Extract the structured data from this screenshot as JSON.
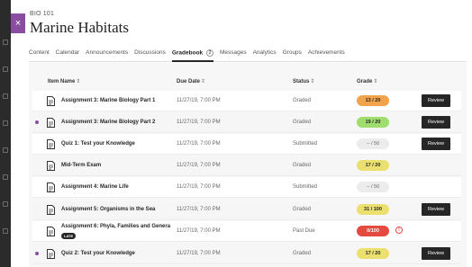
{
  "app": {
    "course_code": "BIO 101",
    "course_title": "Marine Habitats",
    "close_glyph": "×"
  },
  "tabs": [
    {
      "label": "Content"
    },
    {
      "label": "Calendar"
    },
    {
      "label": "Announcements"
    },
    {
      "label": "Discussions"
    },
    {
      "label": "Gradebook",
      "badge": "2",
      "active": true
    },
    {
      "label": "Messages"
    },
    {
      "label": "Analytics"
    },
    {
      "label": "Groups"
    },
    {
      "label": "Achievements"
    }
  ],
  "columns": {
    "item_name": "Item Name",
    "due_date": "Due Date",
    "status": "Status",
    "grade": "Grade",
    "sort_glyph": "⇕"
  },
  "rows": [
    {
      "name": "Assignment 3: Marine Biology Part 1",
      "due": "11/27/19, 7:00 PM",
      "status": "Graded",
      "grade": "13 / 20",
      "grade_color": "orange",
      "review": "Review",
      "new": false
    },
    {
      "name": "Assignment 3: Marine Biology Part 2",
      "due": "11/27/19, 7:00 PM",
      "status": "Graded",
      "grade": "19 / 20",
      "grade_color": "green",
      "review": "Review",
      "new": true
    },
    {
      "name": "Quiz 1: Test your Knowledge",
      "due": "11/27/19, 7:00 PM",
      "status": "Submitted",
      "grade": "-- / 50",
      "grade_color": "grey",
      "review": "Review",
      "new": false
    },
    {
      "name": "Mid-Term Exam",
      "due": "11/27/19, 7:00 PM",
      "status": "Graded",
      "grade": "17 / 20",
      "grade_color": "yellow",
      "new": false
    },
    {
      "name": "Assignment 4: Marine Life",
      "due": "11/27/19, 7:00 PM",
      "status": "Submitted",
      "grade": "-- / 50",
      "grade_color": "grey",
      "new": false
    },
    {
      "name": "Assignment 5: Organisms in the Sea",
      "due": "11/27/19, 7:00 PM",
      "status": "Graded",
      "grade": "31 / 100",
      "grade_color": "yellow",
      "review": "Review",
      "new": false
    },
    {
      "name": "Assignment 6: Phyla, Families and Genera",
      "late": "LATE",
      "due": "11/27/19, 7:00 PM",
      "status": "Past Due",
      "grade": "0/100",
      "grade_color": "red",
      "alert_glyph": "!",
      "new": false
    },
    {
      "name": "Quiz 2: Test your Knowledge",
      "due": "11/27/19, 7:00 PM",
      "status": "Graded",
      "grade": "17 / 20",
      "grade_color": "yellow",
      "review": "Review",
      "new": true
    }
  ],
  "colors": {
    "accent": "#8a4ea0",
    "orange": "#f1a34b",
    "green": "#9fdd6e",
    "yellow": "#ebe06f",
    "red": "#e44a3f",
    "button": "#262626"
  },
  "icons": {
    "rail": [
      "home-icon",
      "profile-icon",
      "calendar-icon",
      "messages-icon",
      "grades-icon",
      "tools-icon",
      "help-icon",
      "signout-icon"
    ],
    "row_item": "document-icon",
    "alert": "alert-icon"
  }
}
